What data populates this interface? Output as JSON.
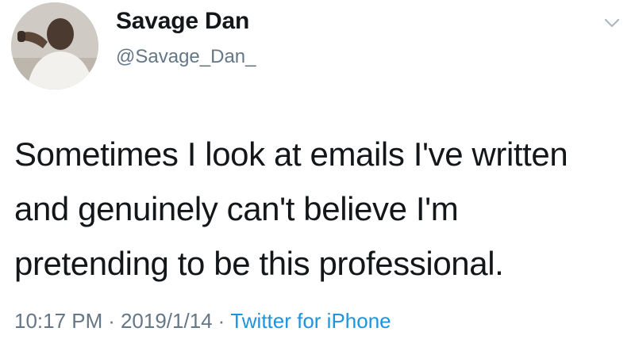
{
  "user": {
    "display_name": "Savage Dan",
    "handle": "@Savage_Dan_"
  },
  "tweet": {
    "lines": [
      "Sometimes I look at emails I've written",
      "and genuinely can't believe I'm",
      "pretending to be this professional."
    ],
    "time": "10:17 PM",
    "separator": "·",
    "date": "2019/1/14",
    "source": "Twitter for iPhone"
  },
  "icons": {
    "menu": "chevron-down-icon",
    "avatar": "user-avatar"
  },
  "colors": {
    "text": "#14171a",
    "secondary": "#657786",
    "link": "#1b95e0"
  }
}
